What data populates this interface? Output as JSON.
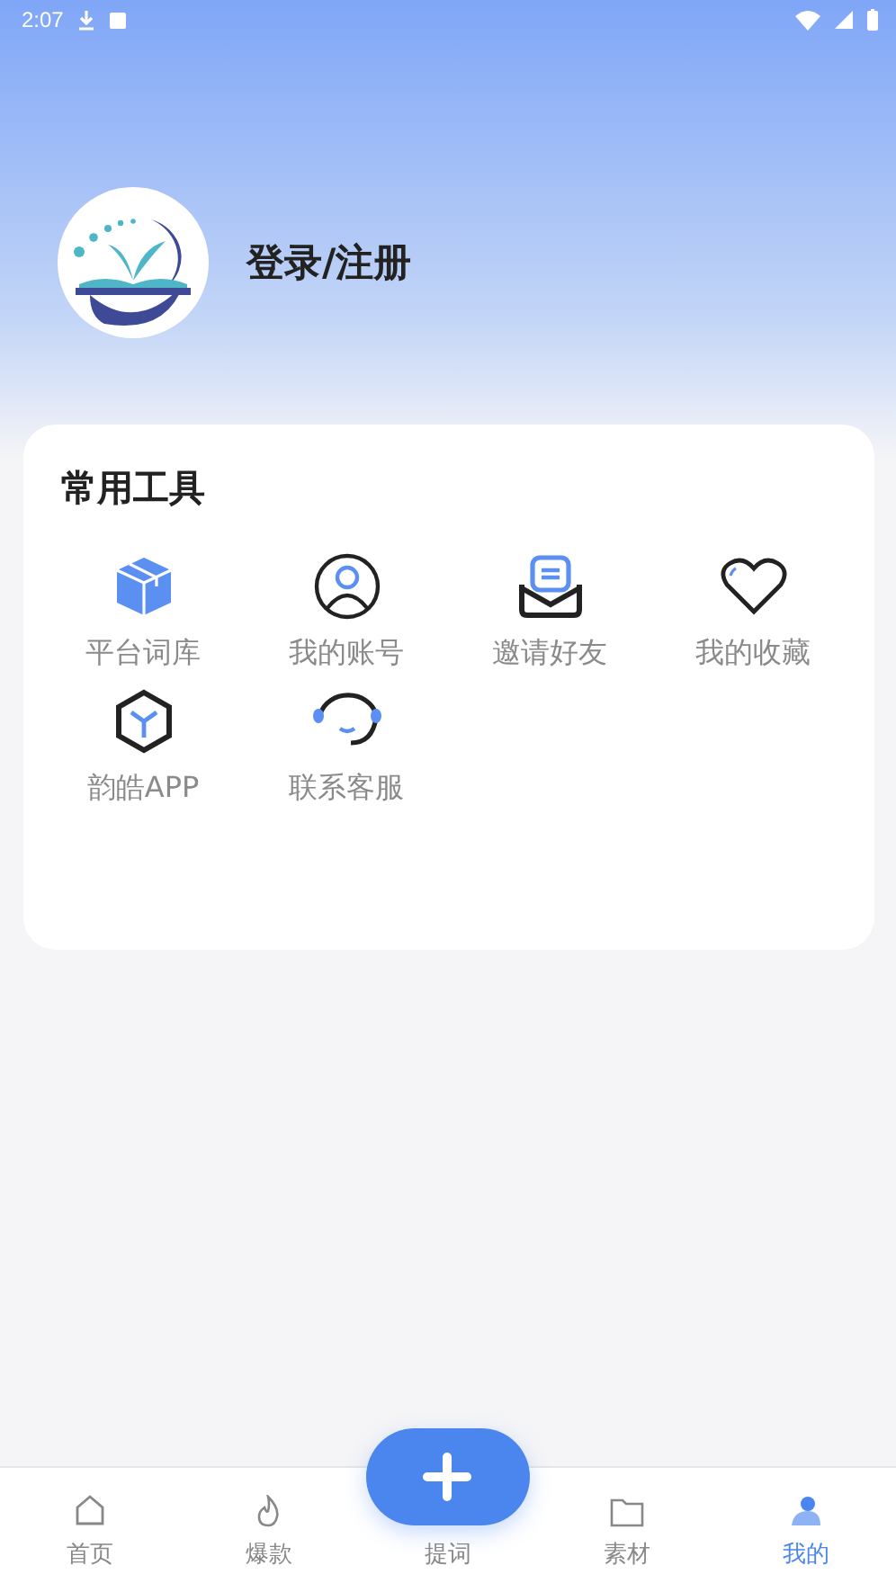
{
  "status_bar": {
    "time": "2:07"
  },
  "profile": {
    "login_label": "登录/注册"
  },
  "tools": {
    "title": "常用工具",
    "items": [
      {
        "kind": "box",
        "label": "平台词库"
      },
      {
        "kind": "person",
        "label": "我的账号"
      },
      {
        "kind": "mail",
        "label": "邀请好友"
      },
      {
        "kind": "heart",
        "label": "我的收藏"
      },
      {
        "kind": "cube",
        "label": "韵皓APP"
      },
      {
        "kind": "headset",
        "label": "联系客服"
      }
    ]
  },
  "tab_bar": {
    "items": [
      {
        "kind": "home",
        "label": "首页",
        "selected": false
      },
      {
        "kind": "fire",
        "label": "爆款",
        "selected": false
      },
      {
        "kind": "add",
        "label": "提词",
        "selected": false
      },
      {
        "kind": "folder",
        "label": "素材",
        "selected": false
      },
      {
        "kind": "user",
        "label": "我的",
        "selected": true
      }
    ]
  }
}
